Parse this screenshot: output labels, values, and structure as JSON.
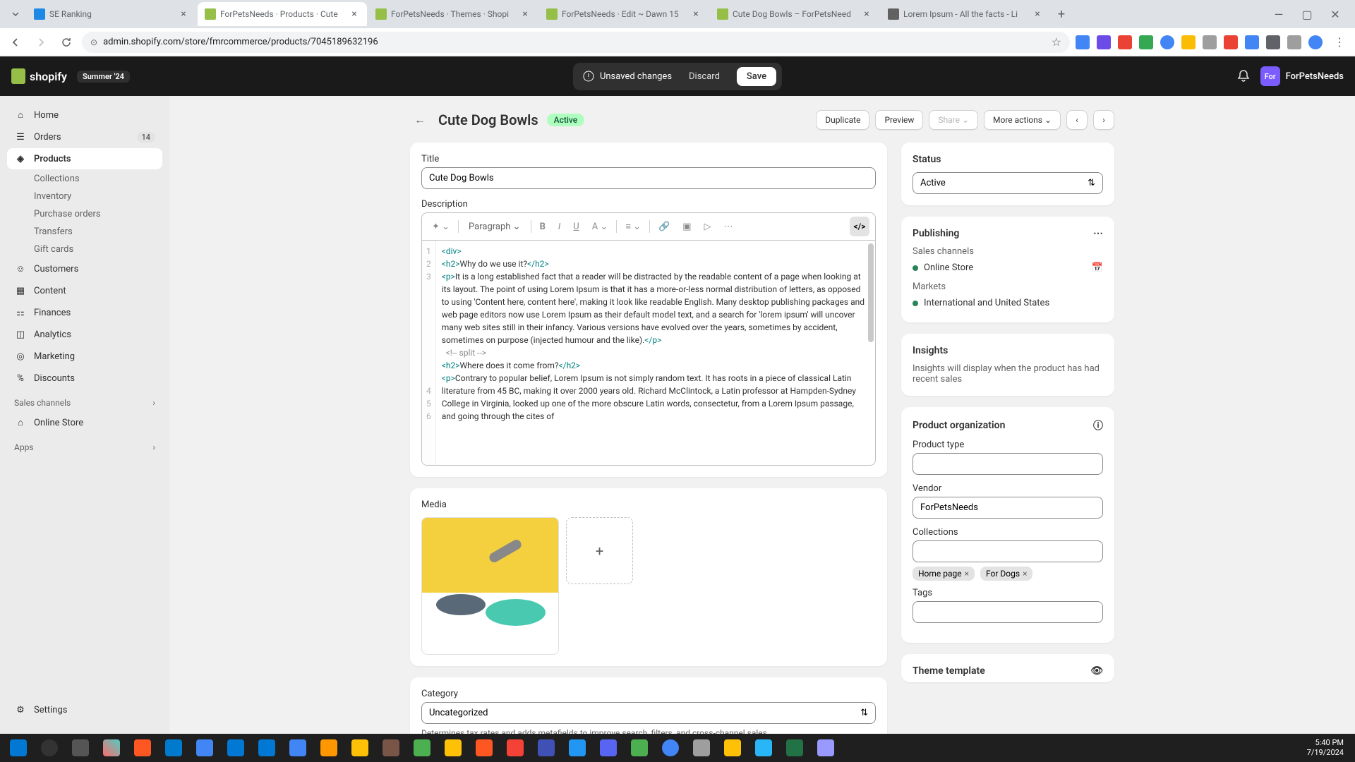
{
  "browser": {
    "tabs": [
      {
        "title": "SE Ranking",
        "favicon": "#1e88e5"
      },
      {
        "title": "ForPetsNeeds · Products · Cute",
        "favicon": "#95bf47",
        "active": true
      },
      {
        "title": "ForPetsNeeds · Themes · Shopi",
        "favicon": "#95bf47"
      },
      {
        "title": "ForPetsNeeds · Edit ~ Dawn 15",
        "favicon": "#95bf47"
      },
      {
        "title": "Cute Dog Bowls – ForPetsNeed",
        "favicon": "#95bf47"
      },
      {
        "title": "Lorem Ipsum - All the facts - Li",
        "favicon": "#616161"
      }
    ],
    "url": "admin.shopify.com/store/fmrcommerce/products/7045189632196"
  },
  "header": {
    "brand": "shopify",
    "season": "Summer '24",
    "unsaved": "Unsaved changes",
    "discard": "Discard",
    "save": "Save",
    "store_initials": "For",
    "store_name": "ForPetsNeeds"
  },
  "sidebar": {
    "home": "Home",
    "orders": "Orders",
    "orders_badge": "14",
    "products": "Products",
    "collections": "Collections",
    "inventory": "Inventory",
    "purchase_orders": "Purchase orders",
    "transfers": "Transfers",
    "gift_cards": "Gift cards",
    "customers": "Customers",
    "content": "Content",
    "finances": "Finances",
    "analytics": "Analytics",
    "marketing": "Marketing",
    "discounts": "Discounts",
    "sales_channels": "Sales channels",
    "online_store": "Online Store",
    "apps": "Apps",
    "settings": "Settings"
  },
  "page": {
    "title": "Cute Dog Bowls",
    "status": "Active",
    "duplicate": "Duplicate",
    "preview": "Preview",
    "share": "Share",
    "more_actions": "More actions"
  },
  "form": {
    "title_label": "Title",
    "title_value": "Cute Dog Bowls",
    "description_label": "Description",
    "paragraph": "Paragraph",
    "media_label": "Media",
    "category_label": "Category",
    "category_value": "Uncategorized",
    "category_help": "Determines tax rates and adds metafields to improve search, filters, and cross-channel sales"
  },
  "code": {
    "lines": [
      "1",
      "2",
      "3",
      "4",
      "5",
      "6"
    ],
    "l1": "<div>",
    "l2_a": "<h2>",
    "l2_b": "Why do we use it?",
    "l2_c": "</h2>",
    "l3_a": "<p>",
    "l3_b": "It is a long established fact that a reader will be distracted by the readable content of a page when looking at its layout. The point of using Lorem Ipsum is that it has a more-or-less normal distribution of letters, as opposed to using 'Content here, content here', making it look like readable English. Many desktop publishing packages and web page editors now use Lorem Ipsum as their default model text, and a search for 'lorem ipsum' will uncover many web sites still in their infancy. Various versions have evolved over the years, sometimes by accident, sometimes on purpose (injected humour and the like).",
    "l3_c": "</p>",
    "l4": "  <!-- split -->",
    "l5_a": "<h2>",
    "l5_b": "Where does it come from?",
    "l5_c": "</h2>",
    "l6_a": "<p>",
    "l6_b": "Contrary to popular belief, Lorem Ipsum is not simply random text. It has roots in a piece of classical Latin literature from 45 BC, making it over 2000 years old. Richard McClintock, a Latin professor at Hampden-Sydney College in Virginia, looked up one of the more obscure Latin words, consectetur, from a Lorem Ipsum passage, and going through the cites of"
  },
  "status_card": {
    "title": "Status",
    "value": "Active"
  },
  "publishing": {
    "title": "Publishing",
    "sales_channels": "Sales channels",
    "online_store": "Online Store",
    "markets": "Markets",
    "intl": "International and United States"
  },
  "insights": {
    "title": "Insights",
    "text": "Insights will display when the product has had recent sales"
  },
  "org": {
    "title": "Product organization",
    "product_type": "Product type",
    "vendor": "Vendor",
    "vendor_value": "ForPetsNeeds",
    "collections": "Collections",
    "tag1": "Home page",
    "tag2": "For Dogs",
    "tags": "Tags",
    "theme_template": "Theme template"
  },
  "taskbar": {
    "time": "5:40 PM",
    "date": "7/19/2024"
  }
}
